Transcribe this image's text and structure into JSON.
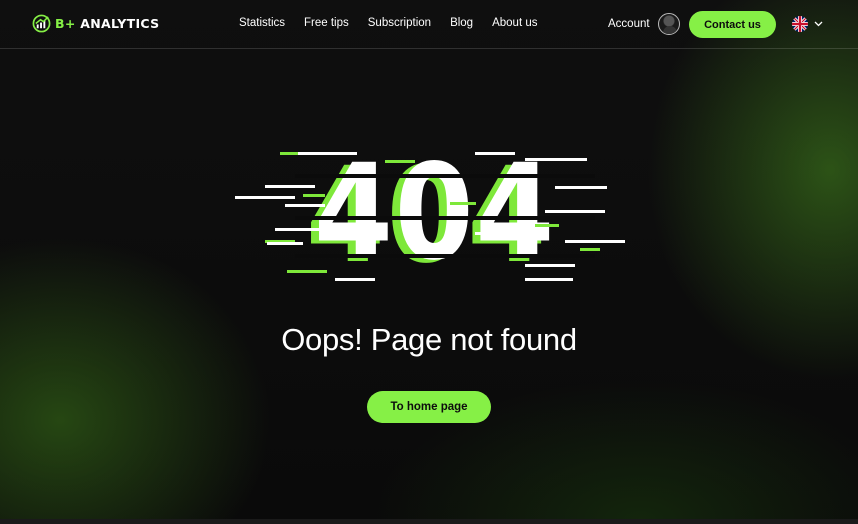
{
  "brand": {
    "prefix": "B+",
    "name": " ANALYTICS",
    "accent_color": "#86f046"
  },
  "nav": {
    "items": [
      {
        "label": "Statistics"
      },
      {
        "label": "Free tips"
      },
      {
        "label": "Subscription"
      },
      {
        "label": "Blog"
      },
      {
        "label": "About us"
      }
    ]
  },
  "account": {
    "label": "Account",
    "avatar_icon": "user-avatar"
  },
  "contact": {
    "label": "Contact us"
  },
  "language": {
    "flag_icon": "uk-flag-icon",
    "chevron_icon": "chevron-down-icon"
  },
  "error": {
    "code": "404",
    "message": "Oops! Page not found",
    "home_button": "To home page"
  },
  "colors": {
    "accent": "#86f046",
    "background": "#0c0c0c",
    "text": "#ffffff"
  }
}
